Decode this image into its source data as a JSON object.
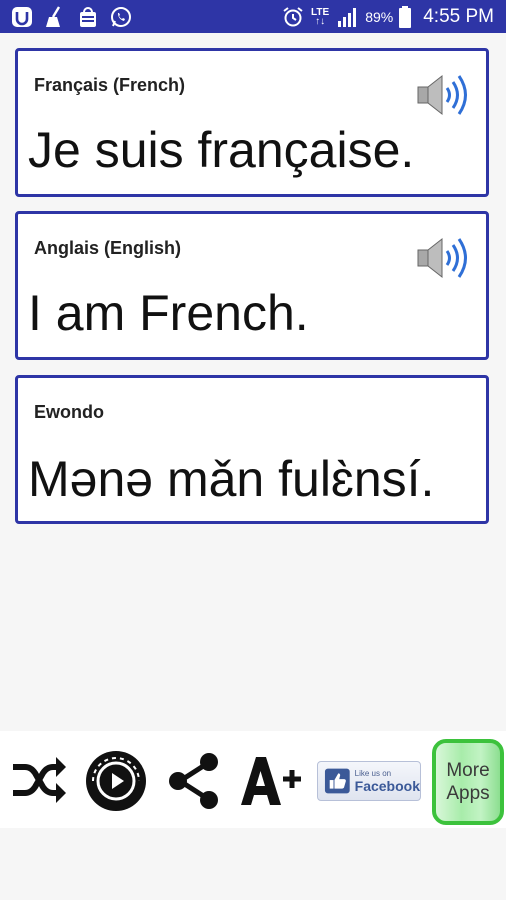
{
  "status_bar": {
    "network": "LTE",
    "battery": "89%",
    "time": "4:55 PM"
  },
  "cards": [
    {
      "label": "Français (French)",
      "text": "Je suis française.",
      "has_audio": true
    },
    {
      "label": "Anglais (English)",
      "text": "I am French.",
      "has_audio": true
    },
    {
      "label": "Ewondo",
      "text": "Mənə mǎn fulɛ̀nsí.",
      "has_audio": false
    }
  ],
  "toolbar": {
    "facebook_small": "Like us on",
    "facebook_label": "Facebook",
    "more_apps_line1": "More",
    "more_apps_line2": "Apps"
  },
  "colors": {
    "accent": "#2e35a6",
    "more_apps_green": "#3cc23c",
    "speaker_wave": "#2f6fd6"
  }
}
